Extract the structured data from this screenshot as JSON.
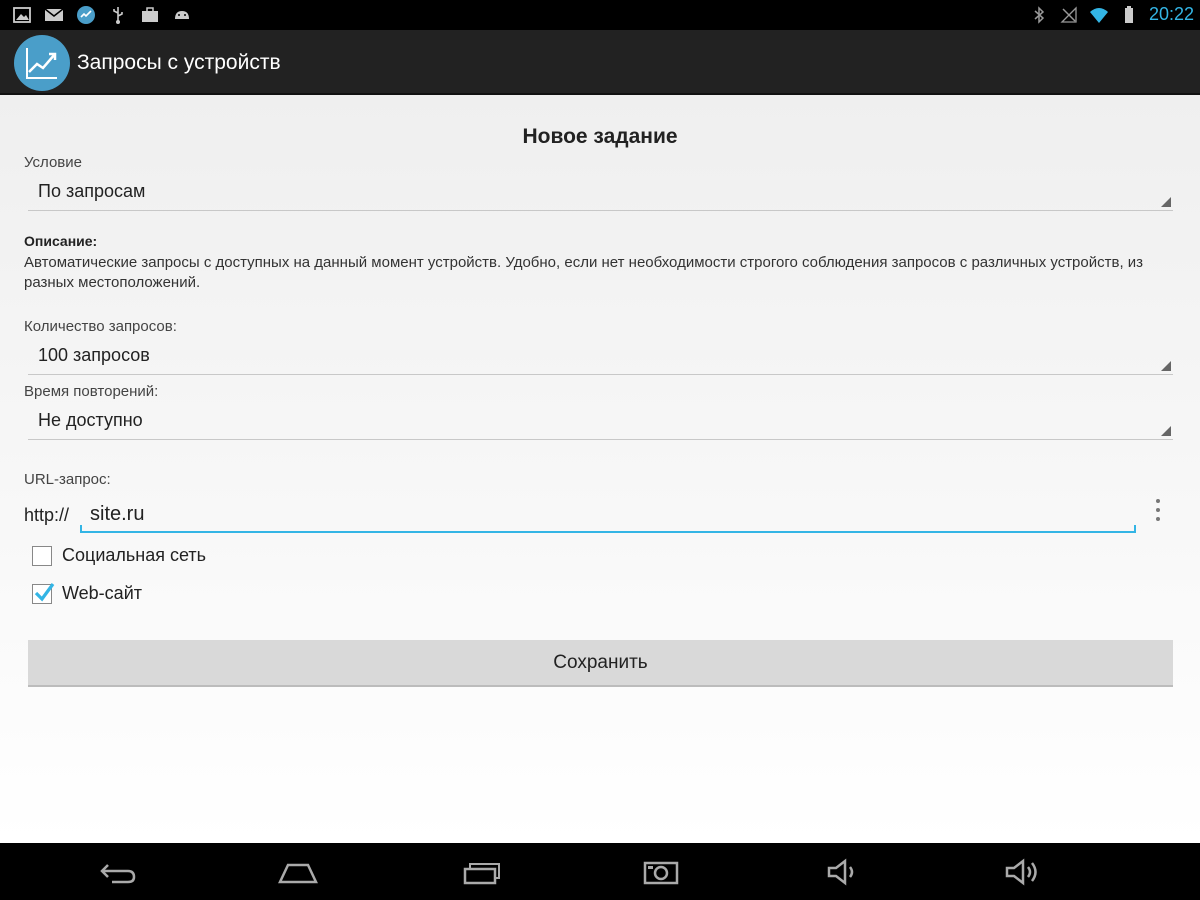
{
  "status_bar": {
    "notification_icons": [
      "gallery-icon",
      "gmail-icon",
      "sync-icon",
      "usb-icon",
      "briefcase-icon",
      "android-icon"
    ],
    "system_icons": [
      "bluetooth-icon",
      "no-signal-icon",
      "wifi-icon",
      "battery-icon"
    ],
    "time": "20:22",
    "accent_color": "#33b5e5"
  },
  "action_bar": {
    "app_icon": "trend-chart-icon",
    "title": "Запросы с устройств"
  },
  "form": {
    "title": "Новое задание",
    "condition": {
      "label": "Условие",
      "value": "По запросам"
    },
    "description": {
      "title": "Описание:",
      "text": "Автоматические запросы с доступных на данный момент устройств. Удобно, если нет необходимости строгого соблюдения запросов с различных устройств, из разных местоположений."
    },
    "request_count": {
      "label": "Количество запросов:",
      "value": "100 запросов"
    },
    "repeat_time": {
      "label": "Время повторений:",
      "value": "Не доступно"
    },
    "url": {
      "label": "URL-запрос:",
      "prefix": "http://",
      "value": "site.ru"
    },
    "checkboxes": [
      {
        "label": "Социальная сеть",
        "checked": false
      },
      {
        "label": "Web-сайт",
        "checked": true
      }
    ],
    "save_label": "Сохранить"
  },
  "nav_bar": {
    "buttons": [
      "back-icon",
      "home-icon",
      "recent-apps-icon",
      "screenshot-icon",
      "volume-down-icon",
      "volume-up-icon"
    ]
  }
}
